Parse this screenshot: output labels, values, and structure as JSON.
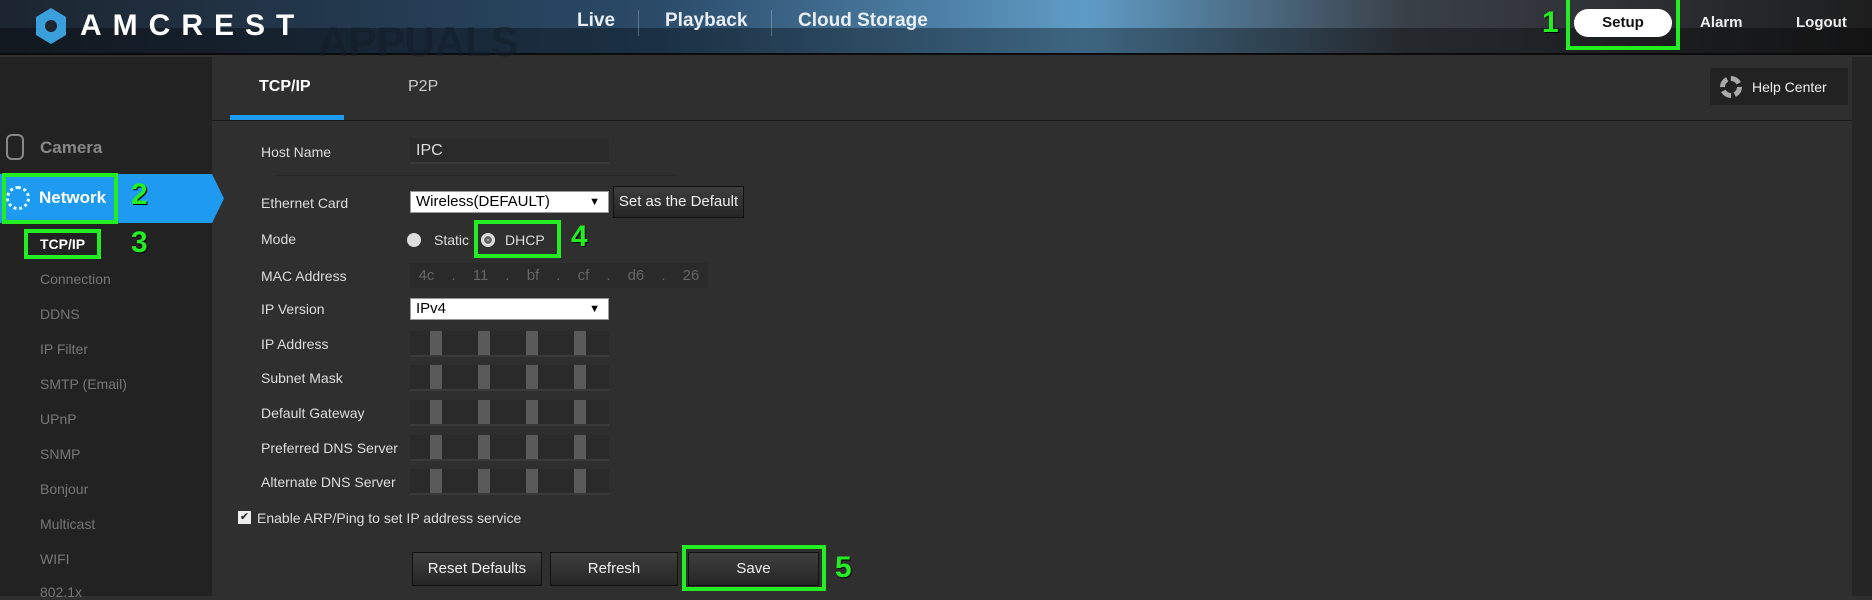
{
  "header": {
    "brand": "AMCREST",
    "watermark": "APPUALS",
    "nav": [
      "Live",
      "Playback",
      "Cloud Storage"
    ],
    "setup": "Setup",
    "alarm": "Alarm",
    "logout": "Logout"
  },
  "sidebar": {
    "camera": "Camera",
    "network": "Network",
    "items": [
      "TCP/IP",
      "Connection",
      "DDNS",
      "IP Filter",
      "SMTP (Email)",
      "UPnP",
      "SNMP",
      "Bonjour",
      "Multicast",
      "WIFI",
      "802.1x"
    ]
  },
  "tabs": [
    "TCP/IP",
    "P2P"
  ],
  "help_center": "Help Center",
  "form": {
    "host_name_label": "Host Name",
    "host_name": "IPC",
    "ethernet_label": "Ethernet Card",
    "ethernet": "Wireless(DEFAULT)",
    "set_default": "Set as the Default",
    "mode_label": "Mode",
    "mode_static": "Static",
    "mode_dhcp": "DHCP",
    "mode_selected": "DHCP",
    "mac_label": "MAC Address",
    "mac": [
      "4c",
      "11",
      "bf",
      "cf",
      "d6",
      "26"
    ],
    "ip_version_label": "IP Version",
    "ip_version": "IPv4",
    "ip_address_label": "IP Address",
    "subnet_label": "Subnet Mask",
    "gateway_label": "Default Gateway",
    "pref_dns_label": "Preferred DNS Server",
    "alt_dns_label": "Alternate DNS Server",
    "arp_label": "Enable ARP/Ping to set IP address service",
    "arp_checked": true,
    "reset": "Reset Defaults",
    "refresh": "Refresh",
    "save": "Save"
  },
  "annotations": [
    "1",
    "2",
    "3",
    "4",
    "5"
  ],
  "colors": {
    "accent": "#1e9bf0",
    "highlight": "#22ee22"
  }
}
